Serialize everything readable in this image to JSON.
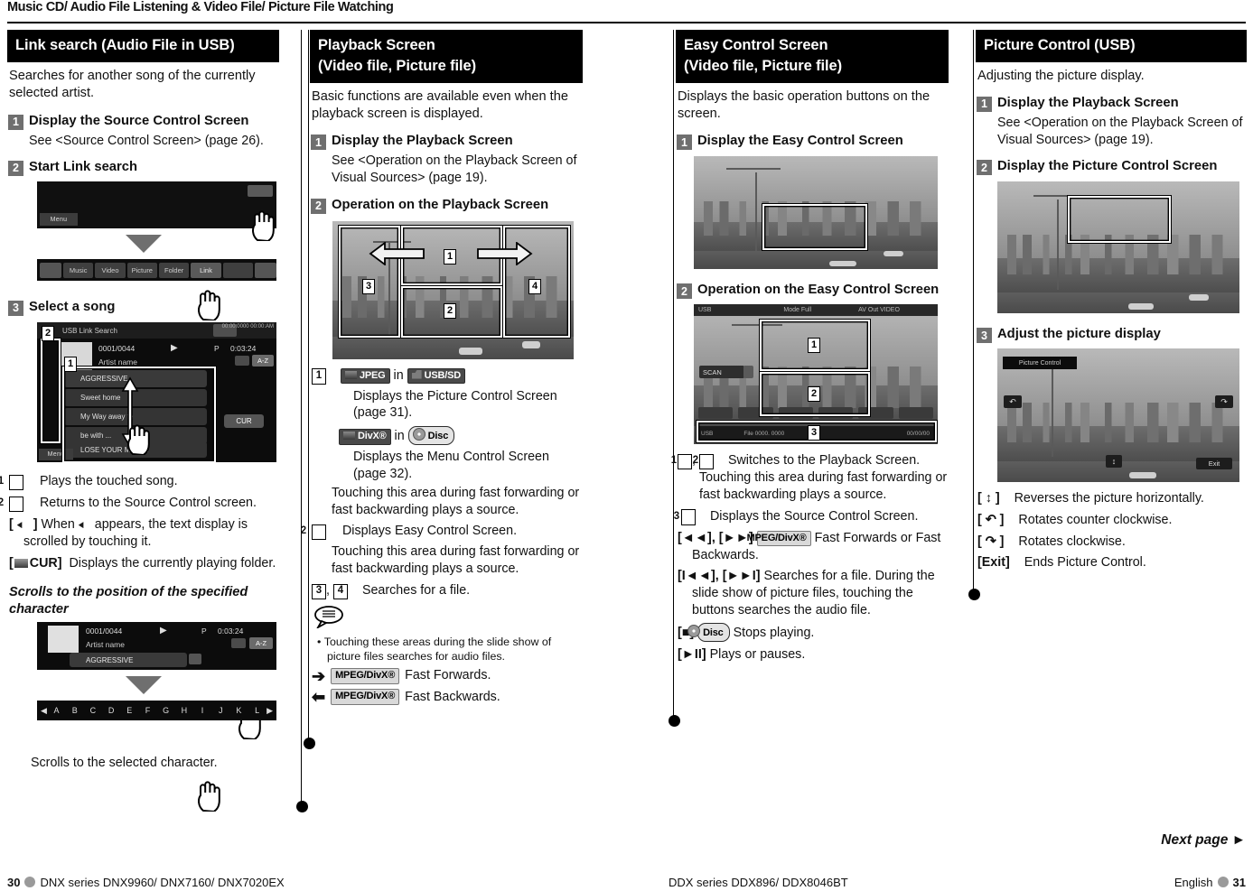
{
  "running_head": "Music CD/ Audio File Listening & Video File/ Picture File Watching",
  "columns": {
    "link_search": {
      "header": "Link search (Audio File in USB)",
      "intro": "Searches for another song of the currently selected artist.",
      "steps": [
        {
          "num": "1",
          "title": "Display the Source Control Screen",
          "body": "See <Source Control Screen> (page 26)."
        },
        {
          "num": "2",
          "title": "Start Link search",
          "body": ""
        },
        {
          "num": "3",
          "title": "Select a song",
          "body": ""
        }
      ],
      "screens": {
        "source_control": {
          "menu_label": "Menu",
          "source_buttons": [
            "Music",
            "Video",
            "Picture",
            "Folder",
            "Link"
          ]
        },
        "link_search": {
          "title": "USB Link Search",
          "track_index": "0001/0044",
          "time_label": "P",
          "time": "0:03:24",
          "artist": "Artist name",
          "sort_button": "A-Z",
          "cur_button": "CUR",
          "menu_label": "Menu",
          "songs": [
            "AGGRESSIVE",
            "Sweet home",
            "My Way away fe",
            "be with ...",
            "LOSE YOUR MIND s"
          ],
          "clock": "00:00:0000 00:00:AM"
        },
        "alphabet": {
          "letters": [
            "A",
            "B",
            "C",
            "D",
            "E",
            "F",
            "G",
            "H",
            "I",
            "J",
            "K",
            "L"
          ]
        }
      },
      "legend": [
        {
          "key": "1",
          "type": "boxnum",
          "text": "Plays the touched song."
        },
        {
          "key": "2",
          "type": "boxnum",
          "text": "Returns to the Source Control screen."
        },
        {
          "key": "[ ⬅ ]",
          "type": "bracket",
          "text": "When ⬅ appears, the text display is scrolled by touching it."
        },
        {
          "key": "[ CUR]",
          "type": "bracket",
          "text": "Displays the currently playing folder."
        }
      ],
      "subheading": "Scrolls to the position of the specified character",
      "footnote": "Scrolls to the selected character."
    },
    "playback_screen": {
      "header_line1": "Playback Screen",
      "header_line2": "(Video file, Picture file)",
      "intro": "Basic functions are available even when the playback screen is displayed.",
      "steps": [
        {
          "num": "1",
          "title": "Display the Playback Screen",
          "body": "See <Operation on the Playback Screen of Visual Sources> (page 19)."
        },
        {
          "num": "2",
          "title": "Operation on the Playback Screen",
          "body": ""
        }
      ],
      "screen_regions": [
        "1",
        "2",
        "3",
        "4"
      ],
      "legend": {
        "item1_num": "1",
        "item1_badge_a": "JPEG",
        "item1_in_a": "in",
        "item1_media_a": "USB/SD",
        "item1_text_a": "Displays the Picture Control Screen (page 31).",
        "item1_badge_b": "DivX®",
        "item1_in_b": "in",
        "item1_media_b": "Disc",
        "item1_text_b": "Displays the Menu Control Screen (page 32).",
        "item1_text_c": "Touching this area during fast forwarding or fast backwarding plays a source.",
        "item2_num": "2",
        "item2_text": "Displays Easy Control Screen.",
        "item2_text_b": "Touching this area during fast forwarding or fast backwarding plays a source.",
        "item34_nums": "3, 4",
        "item34_text": "Searches for a file.",
        "note_bullet": "Touching these areas during the slide show of picture files searches for audio files.",
        "ff_badge": "MPEG/DivX®",
        "ff_text": "Fast Forwards.",
        "fb_badge": "MPEG/DivX®",
        "fb_text": "Fast Backwards."
      }
    },
    "easy_control": {
      "header_line1": "Easy Control Screen",
      "header_line2": "(Video file, Picture file)",
      "intro": "Displays the basic operation buttons on the screen.",
      "steps": [
        {
          "num": "1",
          "title": "Display the Easy Control Screen",
          "body": ""
        },
        {
          "num": "2",
          "title": "Operation on the Easy Control Screen",
          "body": ""
        }
      ],
      "screen_osd": {
        "source": "USB",
        "mode": "Mode  Full",
        "right": "AV Out  VIDEO",
        "scan": "SCAN",
        "bottom_left": "USB",
        "bottom_center": "File 0000. 0000",
        "bottom_right": "00/00/00"
      },
      "screen_regions": [
        "1",
        "2",
        "3"
      ],
      "legend": [
        {
          "key": "1, 2",
          "type": "boxnums",
          "text": "Switches to the Playback Screen. Touching this area during fast forwarding or fast backwarding plays a source."
        },
        {
          "key": "3",
          "type": "boxnum",
          "text": "Displays the Source Control Screen."
        },
        {
          "key": "[◄◄], [►►]",
          "type": "bracket",
          "badge": "MPEG/DivX®",
          "text": "Fast Forwards or Fast Backwards."
        },
        {
          "key": "[I◄◄], [►►I]",
          "type": "bracket",
          "text": "Searches for a file. During the slide show of picture files, touching the buttons searches the audio file."
        },
        {
          "key": "[■]",
          "type": "bracket",
          "badge": "Disc",
          "text": "Stops playing."
        },
        {
          "key": "[►II]",
          "type": "bracket",
          "text": "Plays or pauses."
        }
      ]
    },
    "picture_control": {
      "header": "Picture Control (USB)",
      "intro": "Adjusting the picture display.",
      "steps": [
        {
          "num": "1",
          "title": "Display the Playback Screen",
          "body": "See <Operation on the Playback Screen of Visual Sources> (page 19)."
        },
        {
          "num": "2",
          "title": "Display the Picture Control Screen",
          "body": ""
        },
        {
          "num": "3",
          "title": "Adjust the picture display",
          "body": ""
        }
      ],
      "screen_title": "Picture Control",
      "screen_exit": "Exit",
      "legend": [
        {
          "key": "[ ↕ ]",
          "text": "Reverses the picture horizontally."
        },
        {
          "key": "[ ↶ ]",
          "text": "Rotates counter clockwise."
        },
        {
          "key": "[ ↷ ]",
          "text": "Rotates clockwise."
        },
        {
          "key": "[Exit]",
          "text": "Ends Picture Control."
        }
      ]
    }
  },
  "footer": {
    "next_page": "Next page ►",
    "left_page": "30",
    "left_series": "DNX series   DNX9960/ DNX7160/ DNX7020EX",
    "mid_series": "DDX series   DDX896/ DDX8046BT",
    "right_lang": "English",
    "right_page": "31"
  }
}
